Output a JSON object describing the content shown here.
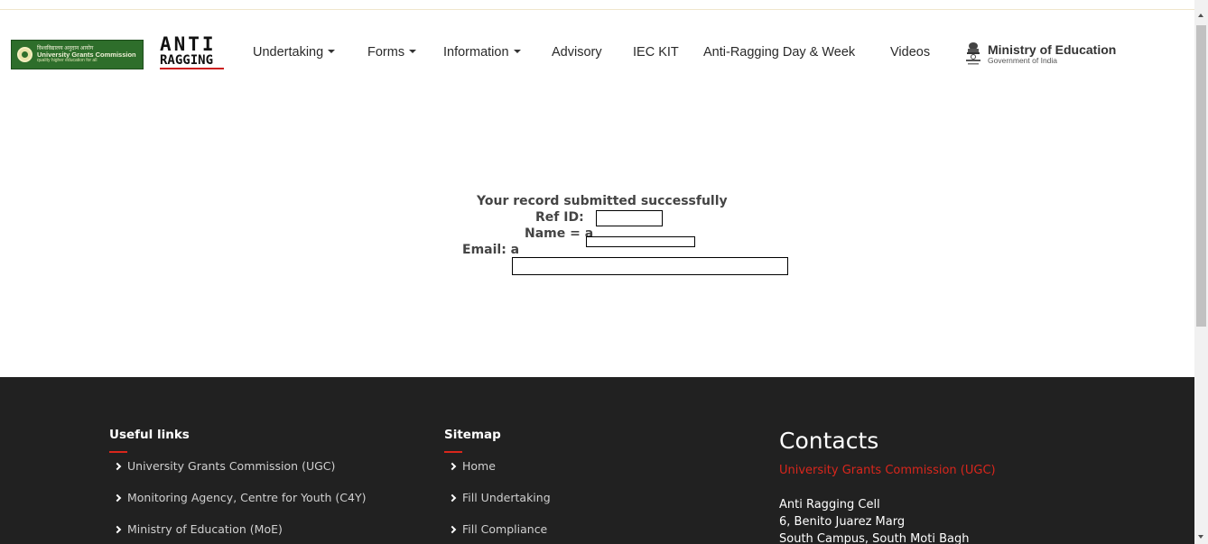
{
  "header": {
    "ugc_logo": {
      "hindi": "विश्वविद्यालय अनुदान आयोग",
      "name": "University Grants Commission",
      "tagline": "quality higher education for all"
    },
    "anti_ragging_logo": {
      "line1": "ANTI",
      "line2": "RAGGING"
    },
    "nav": [
      {
        "label": "Undertaking",
        "dropdown": true
      },
      {
        "label": "Forms",
        "dropdown": true
      },
      {
        "label": "Information",
        "dropdown": true
      },
      {
        "label": "Advisory",
        "dropdown": false
      },
      {
        "label": "IEC KIT",
        "dropdown": false
      },
      {
        "label": "Anti-Ragging Day & Week",
        "dropdown": false
      },
      {
        "label": "Videos",
        "dropdown": false
      }
    ],
    "moe_logo": {
      "title": "Ministry of Education",
      "subtitle": "Government of India"
    }
  },
  "message": {
    "status": "Your record submitted successfully",
    "ref_label": "Ref ID:",
    "name_label": "Name = a",
    "email_label": "Email: a"
  },
  "footer": {
    "useful_links": {
      "heading": "Useful links",
      "items": [
        "University Grants Commission (UGC)",
        "Monitoring Agency, Centre for Youth (C4Y)",
        "Ministry of Education (MoE)"
      ]
    },
    "sitemap": {
      "heading": "Sitemap",
      "items": [
        "Home",
        "Fill Undertaking",
        "Fill Compliance"
      ]
    },
    "contacts": {
      "heading": "Contacts",
      "org": "University Grants Commission (UGC)",
      "address": [
        "Anti Ragging Cell",
        "6, Benito Juarez Marg",
        "South Campus, South Moti Bagh"
      ]
    }
  },
  "colors": {
    "accent_red": "#d9261c",
    "footer_bg": "#212121",
    "ugc_green": "#2e6e2b"
  }
}
